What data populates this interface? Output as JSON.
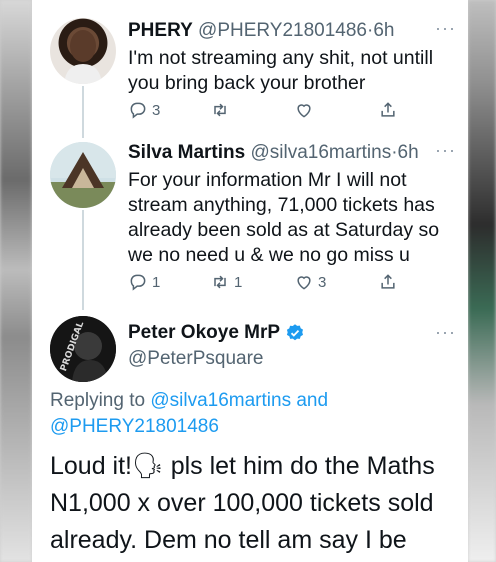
{
  "tweets": [
    {
      "name": "PHERY",
      "handle": "@PHERY21801486",
      "time": "6h",
      "text_lines": [
        "I'm not streaming any shit, not untill",
        "you bring back your brother"
      ],
      "replies": "3",
      "retweets": "",
      "likes": ""
    },
    {
      "name": "Silva Martins",
      "handle": "@silva16martins",
      "time": "6h",
      "text_lines": [
        "For your information Mr I will not",
        "stream anything, 71,000 tickets has",
        "already been sold as at Saturday so",
        "we no need u & we no go miss u"
      ],
      "replies": "1",
      "retweets": "1",
      "likes": "3"
    }
  ],
  "main_tweet": {
    "name": "Peter Okoye MrP",
    "handle": "@PeterPsquare",
    "reply_prefix": "Replying to",
    "reply_user1": "@silva16martins",
    "reply_and": "and",
    "reply_user2": "@PHERY21801486",
    "text_lines": [
      "Loud it!🗣 pls let him do the Maths",
      "N1,000 x over 100,000 tickets sold",
      "already. Dem no tell am say I be"
    ],
    "avatar_text": "PRODIGAL"
  },
  "ui": {
    "more": "···",
    "separator": "·"
  },
  "colors": {
    "accent": "#1d9bf0",
    "verified": "#1d9bf0",
    "muted": "#536471"
  }
}
